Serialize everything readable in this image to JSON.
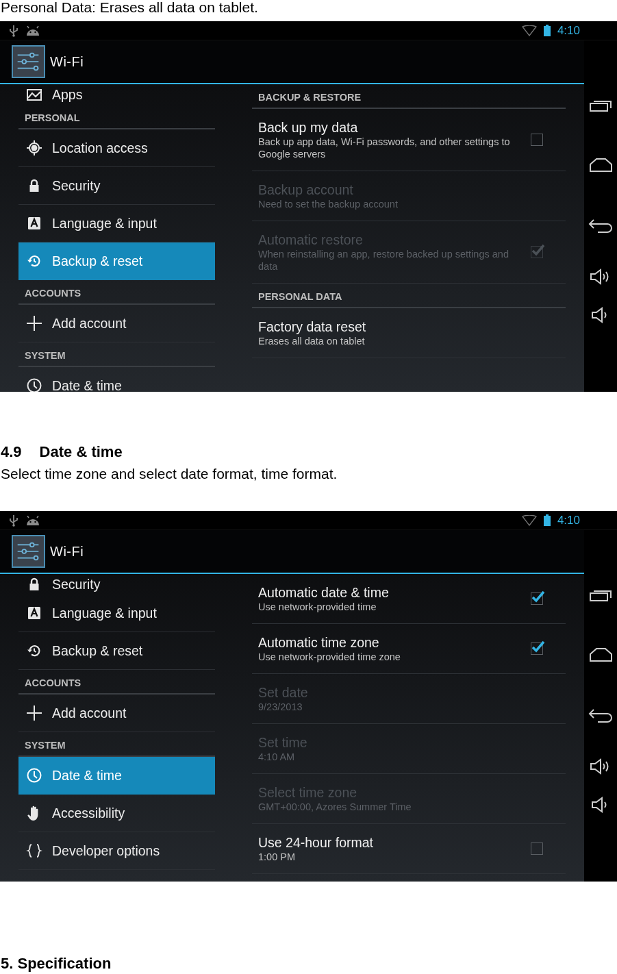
{
  "intro": "Personal Data: Erases all data on tablet.",
  "screens": [
    {
      "status_bar": {
        "time": "4:10"
      },
      "action_bar": {
        "title": "Wi-Fi"
      },
      "sidebar": [
        {
          "kind": "apps",
          "label": "Apps",
          "selected": false
        },
        {
          "kind": "header",
          "label": "PERSONAL"
        },
        {
          "kind": "location",
          "label": "Location access",
          "selected": false
        },
        {
          "kind": "security",
          "label": "Security",
          "selected": false
        },
        {
          "kind": "language",
          "label": "Language & input",
          "selected": false
        },
        {
          "kind": "backup",
          "label": "Backup & reset",
          "selected": true
        },
        {
          "kind": "header",
          "label": "ACCOUNTS"
        },
        {
          "kind": "add",
          "label": "Add account",
          "selected": false
        },
        {
          "kind": "header",
          "label": "SYSTEM"
        },
        {
          "kind": "datetime",
          "label": "Date & time",
          "selected": false
        }
      ],
      "panel": [
        {
          "kind": "header",
          "title": "BACKUP & RESTORE"
        },
        {
          "kind": "checkbox",
          "title": "Back up my data",
          "summary": "Back up app data, Wi-Fi passwords, and other settings to Google servers",
          "disabled": false,
          "checked": false
        },
        {
          "kind": "plain",
          "title": "Backup account",
          "summary": "Need to set the backup account",
          "disabled": true
        },
        {
          "kind": "checkbox",
          "title": "Automatic restore",
          "summary": "When reinstalling an app, restore backed up settings and data",
          "disabled": true,
          "checked": true
        },
        {
          "kind": "header",
          "title": "PERSONAL DATA"
        },
        {
          "kind": "plain",
          "title": "Factory data reset",
          "summary": "Erases all data on tablet",
          "disabled": false
        }
      ]
    },
    {
      "status_bar": {
        "time": "4:10"
      },
      "action_bar": {
        "title": "Wi-Fi"
      },
      "sidebar": [
        {
          "kind": "security",
          "label": "Security",
          "selected": false
        },
        {
          "kind": "language",
          "label": "Language & input",
          "selected": false
        },
        {
          "kind": "backup",
          "label": "Backup & reset",
          "selected": false
        },
        {
          "kind": "header",
          "label": "ACCOUNTS"
        },
        {
          "kind": "add",
          "label": "Add account",
          "selected": false
        },
        {
          "kind": "header",
          "label": "SYSTEM"
        },
        {
          "kind": "datetime",
          "label": "Date & time",
          "selected": true
        },
        {
          "kind": "accessibility",
          "label": "Accessibility",
          "selected": false
        },
        {
          "kind": "developer",
          "label": "Developer options",
          "selected": false
        }
      ],
      "panel": [
        {
          "kind": "checkbox",
          "title": "Automatic date & time",
          "summary": "Use network-provided time",
          "disabled": false,
          "checked": true
        },
        {
          "kind": "checkbox",
          "title": "Automatic time zone",
          "summary": "Use network-provided time zone",
          "disabled": false,
          "checked": true
        },
        {
          "kind": "plain",
          "title": "Set date",
          "summary": "9/23/2013",
          "disabled": true
        },
        {
          "kind": "plain",
          "title": "Set time",
          "summary": "4:10 AM",
          "disabled": true
        },
        {
          "kind": "plain",
          "title": "Select time zone",
          "summary": "GMT+00:00, Azores Summer Time",
          "disabled": true
        },
        {
          "kind": "checkbox",
          "title": "Use 24-hour format",
          "summary": "1:00 PM",
          "disabled": false,
          "checked": false
        }
      ]
    }
  ],
  "section": {
    "number": "4.9",
    "title": "Date & time",
    "text": "Select time zone and select date format, time format."
  },
  "next_section": {
    "title": "5. Specification"
  }
}
